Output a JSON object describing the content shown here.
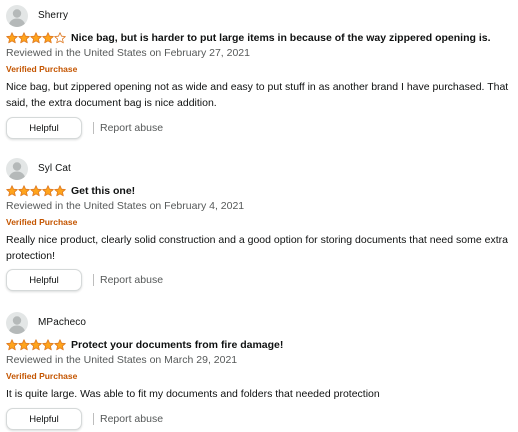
{
  "colors": {
    "star_fill": "#ffa41c",
    "star_stroke": "#de7921",
    "star_empty": "#ffffff",
    "verified": "#c45500",
    "secondary_text": "#565959",
    "avatar_bg": "#e3e6e6",
    "avatar_fg": "#b5b9b9"
  },
  "reviews": [
    {
      "author": "Sherry",
      "avatar_icon": "default-user-icon",
      "rating": 4,
      "rating_max": 5,
      "title": "Nice bag, but is harder to put large items in because of the way zippered opening is.",
      "date": "Reviewed in the United States on February 27, 2021",
      "verified": "Verified Purchase",
      "body": "Nice bag, but zippered opening not as wide and easy to put stuff in as another brand I have purchased. That said, the extra document bag is nice addition.",
      "helpful_label": "Helpful",
      "report_label": "Report abuse"
    },
    {
      "author": "Syl Cat",
      "avatar_icon": "default-user-icon",
      "rating": 5,
      "rating_max": 5,
      "title": "Get this one!",
      "date": "Reviewed in the United States on February 4, 2021",
      "verified": "Verified Purchase",
      "body": "Really nice product, clearly solid construction and a good option for storing documents that need some extra protection!",
      "helpful_label": "Helpful",
      "report_label": "Report abuse"
    },
    {
      "author": "MPacheco",
      "avatar_icon": "default-user-icon",
      "rating": 5,
      "rating_max": 5,
      "title": "Protect your documents from fire damage!",
      "date": "Reviewed in the United States on March 29, 2021",
      "verified": "Verified Purchase",
      "body": "It is quite large. Was able to fit my documents and folders that needed protection",
      "helpful_label": "Helpful",
      "report_label": "Report abuse"
    }
  ]
}
